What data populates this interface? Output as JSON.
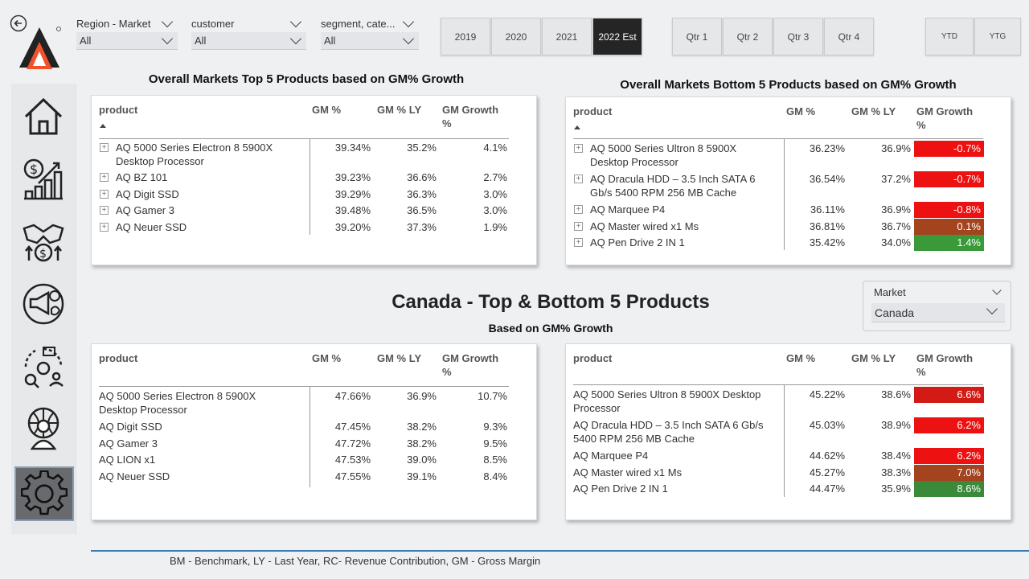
{
  "nav": {
    "items": [
      "home-icon",
      "sales-growth-icon",
      "partnership-icon",
      "marketing-icon",
      "supply-chain-icon",
      "global-user-icon",
      "settings-icon"
    ]
  },
  "filters": {
    "region": {
      "label": "Region - Market",
      "value": "All"
    },
    "customer": {
      "label": "customer",
      "value": "All"
    },
    "segment": {
      "label": "segment, cate...",
      "value": "All"
    }
  },
  "years": [
    "2019",
    "2020",
    "2021",
    "2022 Est"
  ],
  "quarters": [
    "Qtr 1",
    "Qtr 2",
    "Qtr 3",
    "Qtr 4"
  ],
  "periods": [
    "YTD",
    "YTG"
  ],
  "top_section": {
    "left_title": "Overall Markets Top 5 Products based on GM% Growth",
    "right_title": "Overall Markets Bottom 5 Products based on GM% Growth"
  },
  "columns": {
    "product": "product",
    "gm": "GM %",
    "gmly": "GM % LY",
    "growth_1": "GM Growth",
    "growth_2": "%"
  },
  "overall_top": [
    {
      "name1": "AQ 5000 Series Electron 8 5900X",
      "name2": "Desktop Processor",
      "gm": "39.34%",
      "ly": "35.2%",
      "growth": "4.1%"
    },
    {
      "name1": "AQ BZ 101",
      "name2": "",
      "gm": "39.23%",
      "ly": "36.6%",
      "growth": "2.7%"
    },
    {
      "name1": "AQ Digit SSD",
      "name2": "",
      "gm": "39.29%",
      "ly": "36.3%",
      "growth": "3.0%"
    },
    {
      "name1": "AQ Gamer 3",
      "name2": "",
      "gm": "39.48%",
      "ly": "36.5%",
      "growth": "3.0%"
    },
    {
      "name1": "AQ Neuer SSD",
      "name2": "",
      "gm": "39.20%",
      "ly": "37.3%",
      "growth": "1.9%"
    }
  ],
  "overall_bottom": [
    {
      "name1": "AQ 5000 Series Ultron 8 5900X",
      "name2": "Desktop Processor",
      "gm": "36.23%",
      "ly": "36.9%",
      "growth": "-0.7%",
      "color": "#ee1111"
    },
    {
      "name1": "AQ Dracula HDD – 3.5 Inch SATA 6",
      "name2": "Gb/s 5400 RPM 256 MB Cache",
      "gm": "36.54%",
      "ly": "37.2%",
      "growth": "-0.7%",
      "color": "#ee1111"
    },
    {
      "name1": "AQ Marquee P4",
      "name2": "",
      "gm": "36.11%",
      "ly": "36.9%",
      "growth": "-0.8%",
      "color": "#ee1111"
    },
    {
      "name1": "AQ Master wired x1 Ms",
      "name2": "",
      "gm": "36.81%",
      "ly": "36.7%",
      "growth": "0.1%",
      "color": "#a3441f"
    },
    {
      "name1": "AQ Pen Drive 2 IN 1",
      "name2": "",
      "gm": "35.42%",
      "ly": "34.0%",
      "growth": "1.4%",
      "color": "#3a9a3a"
    }
  ],
  "canada": {
    "title": "Canada - Top & Bottom 5 Products",
    "subtitle": "Based on GM% Growth",
    "market_label": "Market",
    "market_value": "Canada"
  },
  "canada_top": [
    {
      "name1": "AQ 5000 Series Electron 8 5900X",
      "name2": "Desktop Processor",
      "gm": "47.66%",
      "ly": "36.9%",
      "growth": "10.7%"
    },
    {
      "name1": "AQ Digit SSD",
      "name2": "",
      "gm": "47.45%",
      "ly": "38.2%",
      "growth": "9.3%"
    },
    {
      "name1": "AQ Gamer 3",
      "name2": "",
      "gm": "47.72%",
      "ly": "38.2%",
      "growth": "9.5%"
    },
    {
      "name1": "AQ LION x1",
      "name2": "",
      "gm": "47.53%",
      "ly": "39.0%",
      "growth": "8.5%"
    },
    {
      "name1": "AQ Neuer SSD",
      "name2": "",
      "gm": "47.55%",
      "ly": "39.1%",
      "growth": "8.4%"
    }
  ],
  "canada_bottom": [
    {
      "name1": "AQ 5000 Series Ultron 8 5900X Desktop",
      "name2": "Processor",
      "gm": "45.22%",
      "ly": "38.6%",
      "growth": "6.6%",
      "color": "#d41a14"
    },
    {
      "name1": "AQ Dracula HDD – 3.5 Inch SATA 6 Gb/s",
      "name2": "5400 RPM 256 MB Cache",
      "gm": "45.03%",
      "ly": "38.9%",
      "growth": "6.2%",
      "color": "#ee1111"
    },
    {
      "name1": "AQ Marquee P4",
      "name2": "",
      "gm": "44.62%",
      "ly": "38.4%",
      "growth": "6.2%",
      "color": "#ee1111"
    },
    {
      "name1": "AQ Master wired x1 Ms",
      "name2": "",
      "gm": "45.27%",
      "ly": "38.3%",
      "growth": "7.0%",
      "color": "#a3441f"
    },
    {
      "name1": "AQ Pen Drive 2 IN 1",
      "name2": "",
      "gm": "44.47%",
      "ly": "35.9%",
      "growth": "8.6%",
      "color": "#3a8a3a"
    }
  ],
  "footer": "BM - Benchmark, LY - Last Year, RC- Revenue Contribution, GM - Gross Margin"
}
